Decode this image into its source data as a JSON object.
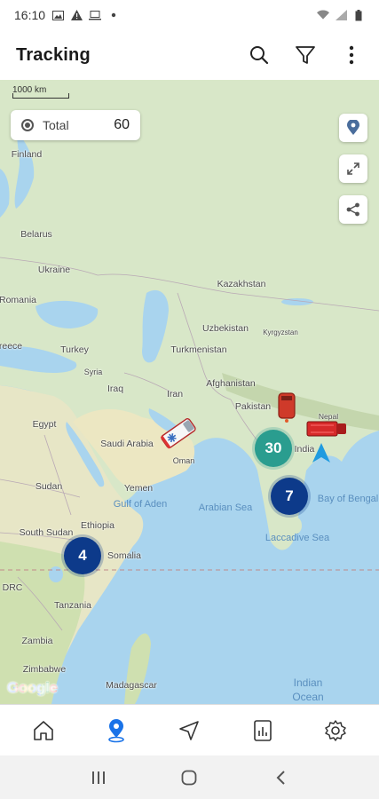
{
  "status_bar": {
    "time": "16:10",
    "left_icons": [
      "image-icon",
      "warning-icon",
      "laptop-icon",
      "dot-icon"
    ],
    "right_icons": [
      "wifi-icon",
      "signal-icon",
      "battery-icon"
    ]
  },
  "app_bar": {
    "title": "Tracking",
    "actions": [
      "search-icon",
      "filter-icon",
      "more-vert-icon"
    ]
  },
  "map": {
    "scale_label": "1000 km",
    "total": {
      "label": "Total",
      "value": "60"
    },
    "side_buttons": [
      "location-pin-icon",
      "fullscreen-icon",
      "share-icon"
    ],
    "labels": {
      "finland": "Finland",
      "belarus": "Belarus",
      "ukraine": "Ukraine",
      "romania": "Romania",
      "reece": "reece",
      "turkey": "Turkey",
      "syria": "Syria",
      "iraq": "Iraq",
      "iran": "Iran",
      "egypt": "Egypt",
      "saudi_arabia": "Saudi Arabia",
      "oman": "Oman",
      "yemen": "Yemen",
      "sudan": "Sudan",
      "south_sudan": "South Sudan",
      "ethiopia": "Ethiopia",
      "somalia": "Somalia",
      "drc": "DRC",
      "tanzania": "Tanzania",
      "zambia": "Zambia",
      "zimbabwe": "Zimbabwe",
      "madagascar": "Madagascar",
      "kazakhstan": "Kazakhstan",
      "uzbekistan": "Uzbekistan",
      "kyrgyzstan": "Kyrgyzstan",
      "turkmenistan": "Turkmenistan",
      "afghanistan": "Afghanistan",
      "pakistan": "Pakistan",
      "india": "India",
      "nepal": "Nepal",
      "gulf_of_aden": "Gulf of Aden",
      "arabian_sea": "Arabian Sea",
      "laccadive_sea": "Laccadive Sea",
      "bay_of_bengal": "Bay of Bengal",
      "indian_ocean_1": "Indian",
      "indian_ocean_2": "Ocean"
    },
    "clusters": [
      {
        "count": "30",
        "color": "#2a9d8f"
      },
      {
        "count": "7",
        "color": "#0d3a8a"
      },
      {
        "count": "4",
        "color": "#0d3a8a"
      }
    ],
    "vehicles": [
      "ambulance-icon",
      "bus-icon",
      "truck-icon",
      "navigation-arrow-icon"
    ],
    "attribution": "Google"
  },
  "bottom_nav": {
    "items": [
      "home-icon",
      "map-pin-icon",
      "navigate-icon",
      "report-icon",
      "settings-icon"
    ],
    "active_index": 1,
    "active_color": "#1a73e8"
  },
  "system_nav": [
    "recents-icon",
    "home-circle-icon",
    "back-icon"
  ]
}
